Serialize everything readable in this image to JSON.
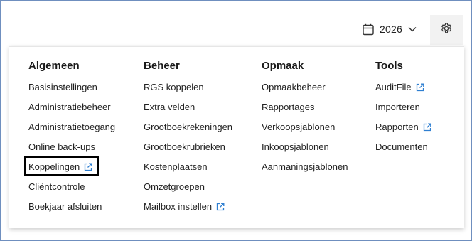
{
  "header": {
    "year": "2026",
    "calendar_icon": "calendar-icon",
    "dropdown_icon": "chevron-down-icon",
    "settings_icon": "gear-icon"
  },
  "menu": {
    "columns": [
      {
        "title": "Algemeen",
        "items": [
          {
            "label": "Basisinstellingen",
            "external": false
          },
          {
            "label": "Administratiebeheer",
            "external": false
          },
          {
            "label": "Administratietoegang",
            "external": false
          },
          {
            "label": "Online back-ups",
            "external": false
          },
          {
            "label": "Koppelingen",
            "external": true,
            "highlighted": true
          },
          {
            "label": "Cliëntcontrole",
            "external": false
          },
          {
            "label": "Boekjaar afsluiten",
            "external": false
          }
        ]
      },
      {
        "title": "Beheer",
        "items": [
          {
            "label": "RGS koppelen",
            "external": false
          },
          {
            "label": "Extra velden",
            "external": false
          },
          {
            "label": "Grootboekrekeningen",
            "external": false
          },
          {
            "label": "Grootboekrubrieken",
            "external": false
          },
          {
            "label": "Kostenplaatsen",
            "external": false
          },
          {
            "label": "Omzetgroepen",
            "external": false
          },
          {
            "label": "Mailbox instellen",
            "external": true
          }
        ]
      },
      {
        "title": "Opmaak",
        "items": [
          {
            "label": "Opmaakbeheer",
            "external": false
          },
          {
            "label": "Rapportages",
            "external": false
          },
          {
            "label": "Verkoopsjablonen",
            "external": false
          },
          {
            "label": "Inkoopsjablonen",
            "external": false
          },
          {
            "label": "Aanmaningsjablonen",
            "external": false
          }
        ]
      },
      {
        "title": "Tools",
        "items": [
          {
            "label": "AuditFile",
            "external": true
          },
          {
            "label": "Importeren",
            "external": false
          },
          {
            "label": "Rapporten",
            "external": true
          },
          {
            "label": "Documenten",
            "external": false
          }
        ]
      }
    ]
  },
  "colors": {
    "accent": "#2f7fd1",
    "frame_border": "#6f8fbf",
    "highlight_border": "#000000",
    "gear_bg": "#f2f2f2"
  }
}
